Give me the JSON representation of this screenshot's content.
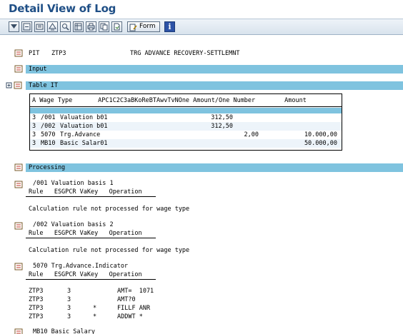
{
  "window": {
    "title": "Detail View of Log"
  },
  "toolbar": {
    "icons": [
      "expand-icon",
      "collapse-icon",
      "expand-subtree-icon",
      "collapse-subtree-icon",
      "find-icon",
      "layout-icon",
      "print-icon",
      "copy-icon",
      "local-file-icon",
      "form-icon",
      "info-icon"
    ],
    "form_label": "Form",
    "info_label": "i"
  },
  "header": {
    "pit": "PIT",
    "name": "ZTP3",
    "desc": "TRG ADVANCE RECOVERY-SETTLEMNT"
  },
  "input": {
    "label": "Input"
  },
  "table_it": {
    "label": "Table IT",
    "header": "A Wage Type       APC1C2C3aBKoReBTAwvTvNOne Amount/One Number        Amount",
    "rows": [
      {
        "a": "3",
        "wt": "/001",
        "txt": "Valuation b01",
        "amt_one": "312,50",
        "number": "",
        "amount": ""
      },
      {
        "a": "3",
        "wt": "/002",
        "txt": "Valuation b01",
        "amt_one": "312,50",
        "number": "",
        "amount": ""
      },
      {
        "a": "3",
        "wt": "5070",
        "txt": "Trg.Advance",
        "amt_one": "",
        "number": "2,00",
        "amount": "10.000,00"
      },
      {
        "a": "3",
        "wt": "MB10",
        "txt": "Basic Salar01",
        "amt_one": "",
        "number": "",
        "amount": "50.000,00"
      }
    ]
  },
  "processing": {
    "label": "Processing"
  },
  "sections": [
    {
      "title": "/001 Valuation basis 1",
      "cols": "Rule   ESGPCR VaKey   Operation",
      "message": "Calculation rule not processed for wage type"
    },
    {
      "title": "/002 Valuation basis 2",
      "cols": "Rule   ESGPCR VaKey   Operation",
      "message": "Calculation rule not processed for wage type"
    },
    {
      "title": "5070 Trg.Advance.Indicator",
      "cols": "Rule   ESGPCR VaKey   Operation",
      "ops": [
        {
          "rule": "ZTP3",
          "es": "3",
          "va": "",
          "op": "AMT=  1071"
        },
        {
          "rule": "ZTP3",
          "es": "3",
          "va": "",
          "op": "AMT?0"
        },
        {
          "rule": "ZTP3",
          "es": "3",
          "va": "*",
          "op": "FILLF ANR"
        },
        {
          "rule": "ZTP3",
          "es": "3",
          "va": "*",
          "op": "ADDWT *"
        }
      ]
    },
    {
      "title": "MB10 Basic Salary"
    }
  ]
}
